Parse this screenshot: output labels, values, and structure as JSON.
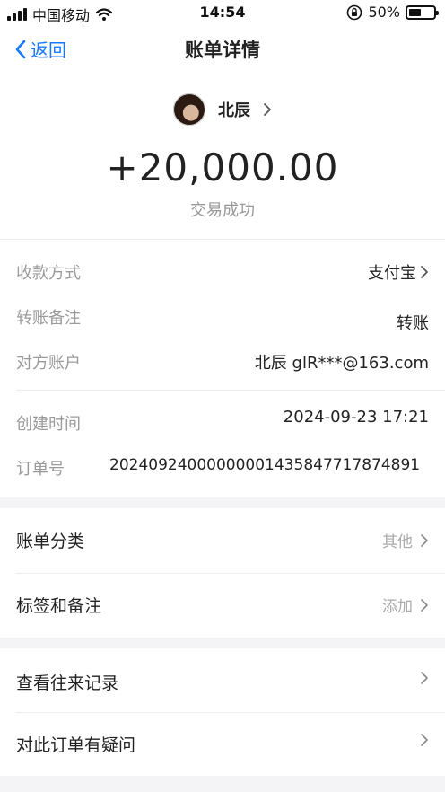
{
  "statusbar": {
    "carrier": "中国移动",
    "time": "14:54",
    "battery": "50%",
    "battery_level": 0.5
  },
  "nav": {
    "back_label": "返回",
    "title": "账单详情"
  },
  "payee": {
    "name": "北辰"
  },
  "amount": "+20,000.00",
  "status": "交易成功",
  "details": {
    "method_label": "收款方式",
    "method_value": "支付宝",
    "remark_label": "转账备注",
    "remark_value": "转账",
    "account_label": "对方账户",
    "account_value": "北辰 glR***@163.com",
    "created_label": "创建时间",
    "created_value": "2024-09-23 17:21",
    "order_label": "订单号",
    "order_value": "20240924000000001435847717874891"
  },
  "options": {
    "category_label": "账单分类",
    "category_value": "其他",
    "tags_label": "标签和备注",
    "tags_value": "添加",
    "history_label": "查看往来记录",
    "question_label": "对此订单有疑问"
  },
  "icons": [
    "signal-icon",
    "wifi-icon",
    "orientation-lock-icon",
    "battery-icon",
    "back-chevron-icon",
    "chevron-right-icon"
  ],
  "colors": {
    "accent": "#1677ff",
    "page_bg": "#f4f4f6"
  }
}
